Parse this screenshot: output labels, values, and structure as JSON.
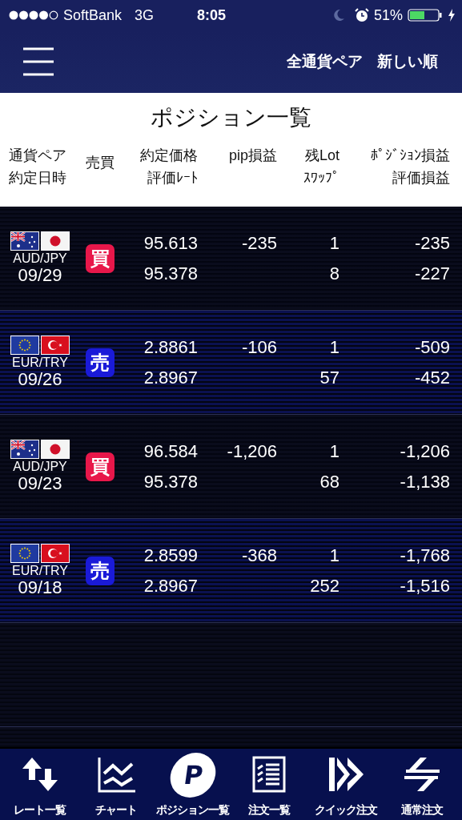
{
  "status_bar": {
    "carrier": "SoftBank",
    "network": "3G",
    "time": "8:05",
    "battery": "51%"
  },
  "nav": {
    "filter": "全通貨ペア",
    "sort": "新しい順"
  },
  "title": "ポジション一覧",
  "columns": [
    {
      "top": "通貨ペア",
      "bottom": "約定日時"
    },
    {
      "top": "売買"
    },
    {
      "top": "約定価格",
      "bottom": "評価ﾚｰﾄ"
    },
    {
      "top": "pip損益"
    },
    {
      "top": "残Lot",
      "bottom": "ｽﾜｯﾌﾟ"
    },
    {
      "top": "ﾎﾟｼﾞｼｮﾝ損益",
      "bottom": "評価損益"
    }
  ],
  "positions": [
    {
      "flags": [
        {
          "kind": "au"
        },
        {
          "kind": "jp"
        }
      ],
      "pair": "AUD/JPY",
      "date": "09/29",
      "kind": "buy",
      "side_label": "買",
      "price": "95.613",
      "rate": "95.378",
      "pips": "-235",
      "lot": "1",
      "swap": "8",
      "pl": "-235",
      "eval": "-227"
    },
    {
      "flags": [
        {
          "kind": "eu"
        },
        {
          "kind": "tr"
        }
      ],
      "pair": "EUR/TRY",
      "date": "09/26",
      "kind": "sell",
      "side_label": "売",
      "price": "2.8861",
      "rate": "2.8967",
      "pips": "-106",
      "lot": "1",
      "swap": "57",
      "pl": "-509",
      "eval": "-452"
    },
    {
      "flags": [
        {
          "kind": "au"
        },
        {
          "kind": "jp"
        }
      ],
      "pair": "AUD/JPY",
      "date": "09/23",
      "kind": "buy",
      "side_label": "買",
      "price": "96.584",
      "rate": "95.378",
      "pips": "-1,206",
      "lot": "1",
      "swap": "68",
      "pl": "-1,206",
      "eval": "-1,138"
    },
    {
      "flags": [
        {
          "kind": "eu"
        },
        {
          "kind": "tr"
        }
      ],
      "pair": "EUR/TRY",
      "date": "09/18",
      "kind": "sell",
      "side_label": "売",
      "price": "2.8599",
      "rate": "2.8967",
      "pips": "-368",
      "lot": "1",
      "swap": "252",
      "pl": "-1,768",
      "eval": "-1,516"
    }
  ],
  "tabs": [
    {
      "kind": "updown",
      "label": "レート一覧"
    },
    {
      "kind": "chart",
      "label": "チャート"
    },
    {
      "kind": "p",
      "label": "ポジション一覧",
      "icon_text": "P"
    },
    {
      "kind": "list",
      "label": "注文一覧"
    },
    {
      "kind": "quick",
      "label": "クイック注文"
    },
    {
      "kind": "swap",
      "label": "通常注文"
    }
  ]
}
